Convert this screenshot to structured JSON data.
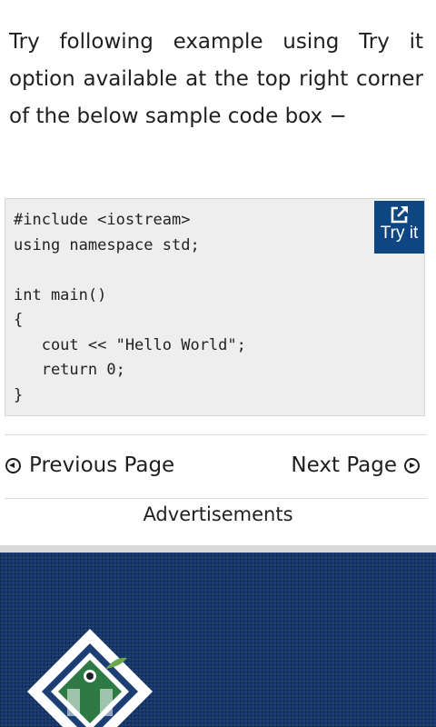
{
  "intro_text": "Try following example using Try it option available at the top right corner of the below sample code box −",
  "code": {
    "content": "#include <iostream>\nusing namespace std;\n\nint main()\n{\n   cout << \"Hello World\";\n   return 0;\n}",
    "try_it_label": "Try it",
    "try_it_icon": "external-link-icon"
  },
  "nav": {
    "previous_label": "Previous Page",
    "previous_icon": "circle-arrow-left-icon",
    "next_label": "Next Page",
    "next_icon": "circle-arrow-right-icon"
  },
  "advertisements_label": "Advertisements",
  "footer": {
    "logo_icon": "tutorialspoint-logo-icon"
  },
  "colors": {
    "try_it_bg": "#0e4682",
    "code_bg": "#eeeeee",
    "footer_bg": "#1b3f75"
  }
}
